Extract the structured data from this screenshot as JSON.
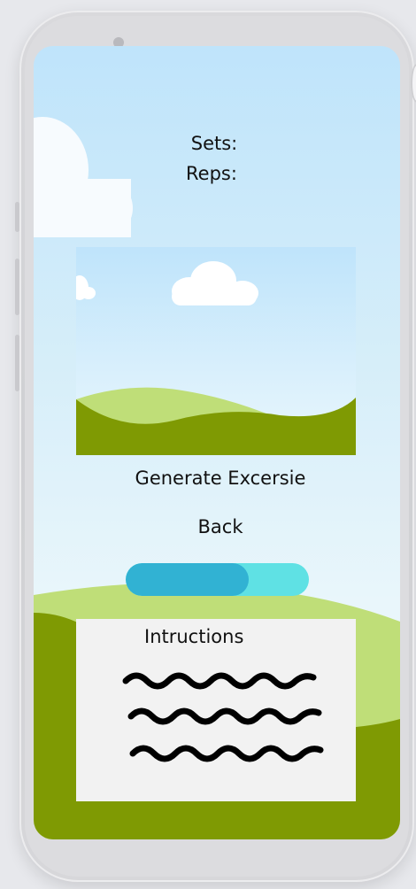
{
  "screen": {
    "sets_label": "Sets:",
    "reps_label": "Reps:",
    "generate_label": "Generate Excersie",
    "back_label": "Back",
    "progress_fraction": 0.67,
    "instructions_title": "Intructions"
  },
  "colors": {
    "sky_top": "#bfe4fb",
    "hill_dark": "#7f9a03",
    "hill_light": "#bfde78",
    "progress_fill": "#31b2d3",
    "progress_track": "#5fe1e4",
    "card_bg": "#f2f2f2"
  },
  "icons": {
    "camera": "camera-dot",
    "instructions_placeholder": "squiggle-lines-icon"
  }
}
